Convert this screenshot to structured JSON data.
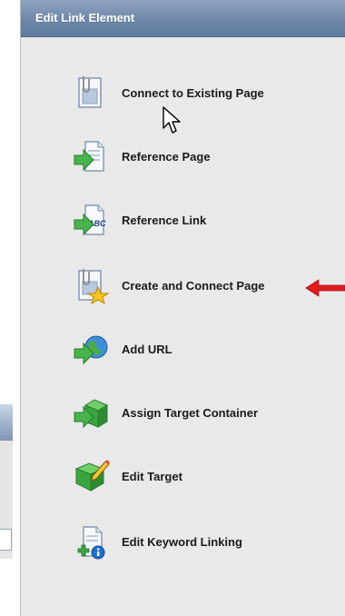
{
  "panel": {
    "title": "Edit Link Element",
    "items": [
      {
        "label": "Connect to Existing Page",
        "icon": "clipboard-page-icon"
      },
      {
        "label": "Reference Page",
        "icon": "green-arrow-page-icon"
      },
      {
        "label": "Reference Link",
        "icon": "green-arrow-abc-icon"
      },
      {
        "label": "Create and Connect Page",
        "icon": "clipboard-star-icon"
      },
      {
        "label": "Add URL",
        "icon": "green-arrow-globe-icon"
      },
      {
        "label": "Assign Target Container",
        "icon": "green-arrow-box-icon"
      },
      {
        "label": "Edit Target",
        "icon": "green-pencil-box-icon"
      },
      {
        "label": "Edit Keyword Linking",
        "icon": "page-plus-info-icon"
      }
    ]
  },
  "colors": {
    "header": "#6f88a9",
    "panel_bg": "#e9e9e9",
    "annotation_arrow": "#e21b1b",
    "icon_green": "#3aa640"
  }
}
